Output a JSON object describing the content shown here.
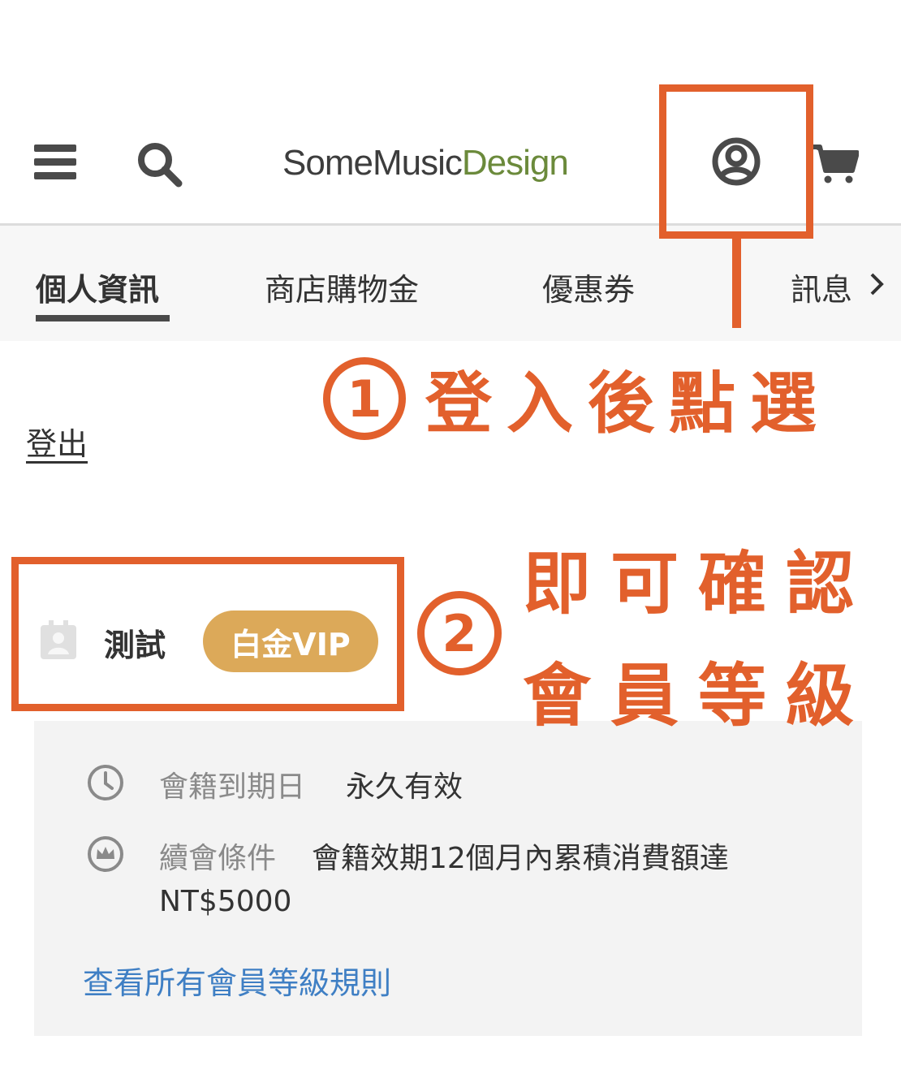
{
  "header": {
    "logo_part1": "SomeMusic",
    "logo_part2": "Design",
    "icons": [
      "menu-icon",
      "search-icon",
      "user-icon",
      "cart-icon"
    ]
  },
  "tabs": [
    {
      "label": "個人資訊",
      "active": true
    },
    {
      "label": "商店購物金",
      "active": false
    },
    {
      "label": "優惠券",
      "active": false
    },
    {
      "label": "訊息",
      "active": false
    }
  ],
  "logout_label": "登出",
  "profile": {
    "name": "測試",
    "tier": "白金VIP"
  },
  "membership": {
    "expiry_label": "會籍到期日",
    "expiry_value": "永久有效",
    "renew_label": "續會條件",
    "renew_value_line1": "會籍效期12個月內累積消費額達",
    "renew_value_line2": "NT$5000",
    "rules_link": "查看所有會員等級規則"
  },
  "annotations": {
    "step1_number": "1",
    "step1_text": "登入後點選",
    "step2_number": "2",
    "step2_text_line1": "即可確認",
    "step2_text_line2": "會員等級",
    "color": "#e2602c"
  },
  "colors": {
    "logo_accent": "#6b8a3b",
    "vip_badge": "#dca959",
    "link": "#3f7fc4"
  }
}
